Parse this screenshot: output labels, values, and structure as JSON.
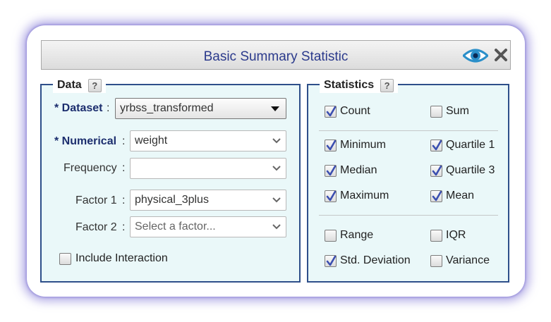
{
  "window": {
    "title": "Basic Summary Statistic",
    "icons": [
      "eye-icon",
      "close-icon"
    ]
  },
  "data_panel": {
    "legend": "Data",
    "help_label": "?",
    "dataset": {
      "label": "* Dataset",
      "value": "yrbss_transformed"
    },
    "numerical": {
      "label": "* Numerical",
      "value": "weight"
    },
    "frequency": {
      "label": "Frequency",
      "value": ""
    },
    "factor1": {
      "label": "Factor 1",
      "value": "physical_3plus"
    },
    "factor2": {
      "label": "Factor 2",
      "placeholder": "Select a factor..."
    },
    "include_interaction": {
      "label": "Include Interaction",
      "checked": false
    }
  },
  "stats_panel": {
    "legend": "Statistics",
    "help_label": "?",
    "items": [
      {
        "label": "Count",
        "checked": true
      },
      {
        "label": "Sum",
        "checked": false
      },
      {
        "label": "Minimum",
        "checked": true
      },
      {
        "label": "Quartile 1",
        "checked": true
      },
      {
        "label": "Median",
        "checked": true
      },
      {
        "label": "Quartile 3",
        "checked": true
      },
      {
        "label": "Maximum",
        "checked": true
      },
      {
        "label": "Mean",
        "checked": true
      },
      {
        "label": "Range",
        "checked": false
      },
      {
        "label": "IQR",
        "checked": false
      },
      {
        "label": "Std. Deviation",
        "checked": true
      },
      {
        "label": "Variance",
        "checked": false
      }
    ]
  },
  "colors": {
    "accent": "#2e4f8a",
    "title_text": "#2b3a8c",
    "panel_bg": "#eaf8f9",
    "check_mark": "#3b4fb0"
  }
}
